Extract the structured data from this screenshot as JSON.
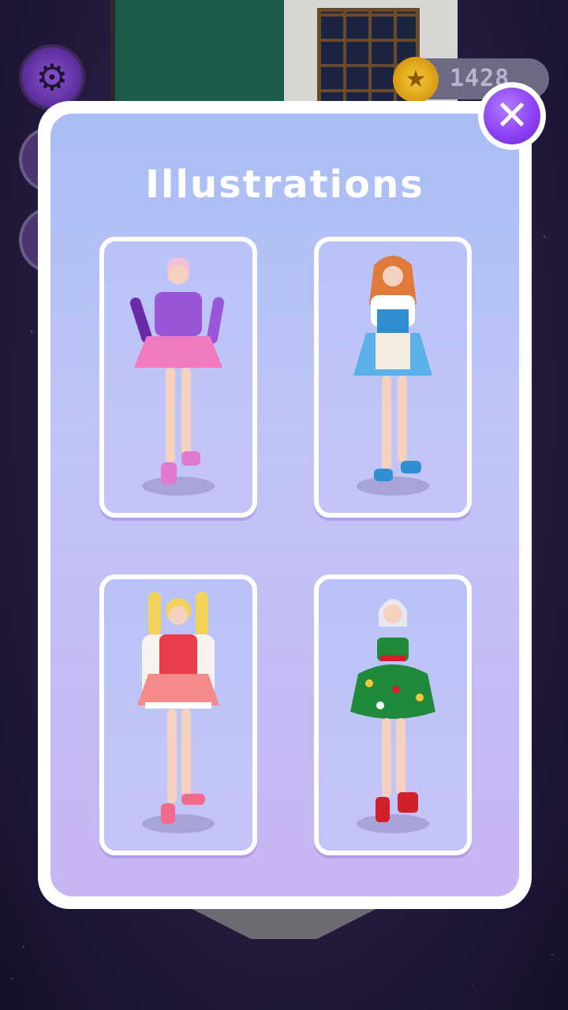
{
  "screen": {
    "coin_icon": "coin-star-icon",
    "coin_amount": "1428"
  },
  "sidebar": {
    "settings_icon": "gear-icon"
  },
  "dialog": {
    "title": "Illustrations",
    "close_icon": "close-icon",
    "cards": [
      {
        "name": "illustration-purple-jacket-outfit",
        "palette": {
          "hair": "#f2c0d8",
          "top": "#9a55d8",
          "skirt": "#f07ac0",
          "shoes": "#e07ad0"
        }
      },
      {
        "name": "illustration-blue-dirndl-outfit",
        "palette": {
          "hair": "#e07a3a",
          "top": "#ffffff",
          "skirt": "#5ab0e8",
          "shoes": "#2f8fd0"
        }
      },
      {
        "name": "illustration-pink-lolita-outfit",
        "palette": {
          "hair": "#f3d25a",
          "top": "#e83d4a",
          "skirt": "#f48a8a",
          "shoes": "#f06a8a"
        }
      },
      {
        "name": "illustration-christmas-tree-dress",
        "palette": {
          "hair": "#e8e8f0",
          "top": "#1f8a3a",
          "skirt": "#1f8a3a",
          "shoes": "#d0202a"
        }
      }
    ]
  },
  "colors": {
    "accent": "#8a3ef2",
    "dialog_bg": "#bfc5f6",
    "coin": "#f7c93a"
  }
}
